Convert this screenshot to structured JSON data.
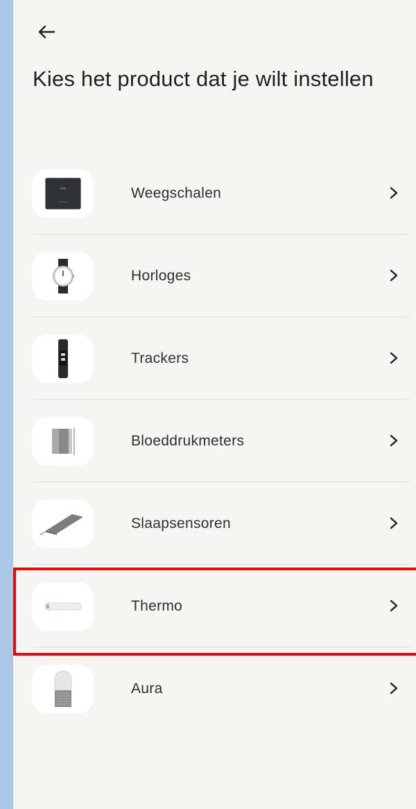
{
  "header": {
    "back_icon": "arrow-left-icon",
    "title": "Kies het product dat je wilt instellen"
  },
  "products": [
    {
      "label": "Weegschalen",
      "icon": "scale-icon"
    },
    {
      "label": "Horloges",
      "icon": "watch-icon"
    },
    {
      "label": "Trackers",
      "icon": "tracker-icon"
    },
    {
      "label": "Bloeddrukmeters",
      "icon": "blood-pressure-monitor-icon"
    },
    {
      "label": "Slaapsensoren",
      "icon": "sleep-sensor-icon"
    },
    {
      "label": "Thermo",
      "icon": "thermometer-icon"
    },
    {
      "label": "Aura",
      "icon": "aura-device-icon"
    }
  ],
  "chevron_icon": "chevron-right-icon",
  "colors": {
    "side_strip": "#aec6e8",
    "background": "#f5f5f4",
    "highlight": "#e60a0a"
  }
}
